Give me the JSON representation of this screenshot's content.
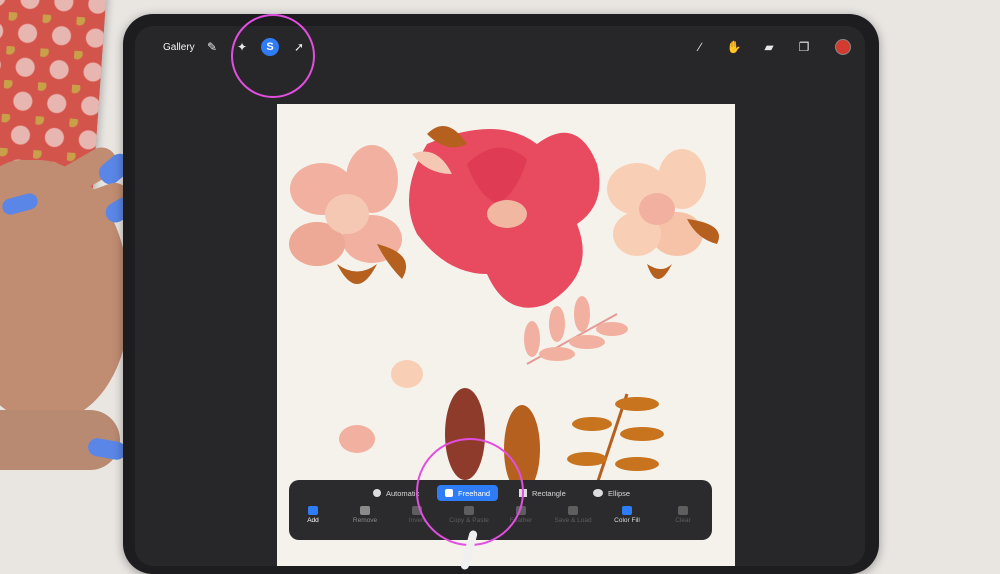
{
  "app": {
    "topbar": {
      "gallery_label": "Gallery",
      "left_tools": [
        {
          "name": "wrench-icon",
          "glyph": "✎"
        },
        {
          "name": "magic-wand-icon",
          "glyph": "✦"
        },
        {
          "name": "selection-icon",
          "glyph": "S",
          "active": true
        },
        {
          "name": "transform-arrow-icon",
          "glyph": "➚"
        }
      ],
      "right_tools": [
        {
          "name": "brush-icon",
          "glyph": "∕"
        },
        {
          "name": "smudge-icon",
          "glyph": "✋"
        },
        {
          "name": "eraser-icon",
          "glyph": "▰"
        },
        {
          "name": "layers-icon",
          "glyph": "❐"
        }
      ],
      "color_swatch": "#d23b2f"
    },
    "selection_toolbar": {
      "modes": [
        {
          "label": "Automatic",
          "active": false
        },
        {
          "label": "Freehand",
          "active": true
        },
        {
          "label": "Rectangle",
          "active": false
        },
        {
          "label": "Ellipse",
          "active": false
        }
      ],
      "actions": [
        {
          "label": "Add",
          "state": "on"
        },
        {
          "label": "Remove",
          "state": "normal"
        },
        {
          "label": "Invert",
          "state": "dim"
        },
        {
          "label": "Copy & Paste",
          "state": "dim"
        },
        {
          "label": "Feather",
          "state": "dim"
        },
        {
          "label": "Save & Load",
          "state": "dim"
        },
        {
          "label": "Color Fill",
          "state": "normal"
        },
        {
          "label": "Clear",
          "state": "dim"
        }
      ]
    },
    "colors": {
      "accent": "#2e7cf6",
      "annotation": "#e24fe0",
      "hibiscus": "#e84a5f",
      "peach": "#f2b7a0",
      "rust": "#b5601f"
    }
  }
}
